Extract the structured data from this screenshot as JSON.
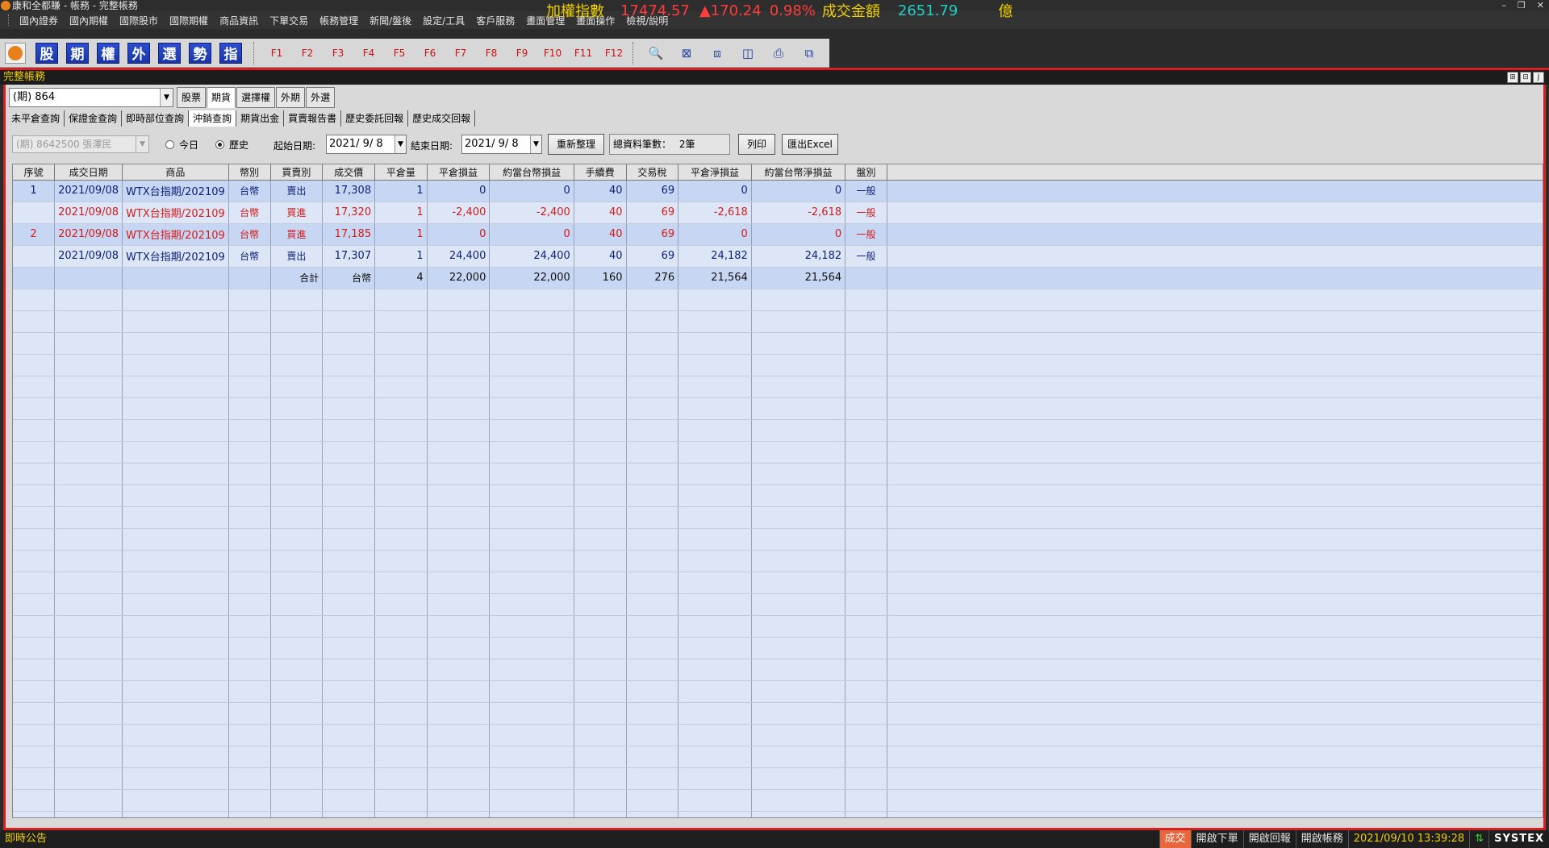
{
  "window": {
    "title": "康和全都賺 - 帳務 - 完整帳務",
    "min": "–",
    "max": "❐",
    "close": "✕"
  },
  "menu": [
    "國內證券",
    "國內期權",
    "國際股市",
    "國際期權",
    "商品資訊",
    "下單交易",
    "帳務管理",
    "新聞/盤後",
    "設定/工具",
    "客戶服務",
    "畫面管理",
    "畫面操作",
    "檢視/說明"
  ],
  "ticker": {
    "label1": "加權指數",
    "index": "17474.57",
    "change": "▲170.24",
    "pct": "0.98%",
    "label2": "成交金額",
    "amount": "2651.79",
    "unit": "億"
  },
  "toolbar": {
    "chars": [
      "股",
      "期",
      "權",
      "外",
      "選",
      "勢",
      "指"
    ],
    "fkeys": [
      "F1",
      "F2",
      "F3",
      "F4",
      "F5",
      "F6",
      "F7",
      "F8",
      "F9",
      "F10",
      "F11",
      "F12"
    ],
    "icons": [
      "🔍",
      "⊠",
      "⧈",
      "◫",
      "⎙",
      "⧉"
    ]
  },
  "subwindow": {
    "title": "完整帳務",
    "ctrls": [
      "⊞",
      "⊟",
      "J"
    ]
  },
  "account": {
    "value": "(期)  864"
  },
  "market_tabs": [
    "股票",
    "期貨",
    "選擇權",
    "外期",
    "外選"
  ],
  "query_tabs": [
    "未平倉查詢",
    "保證金查詢",
    "即時部位查詢",
    "沖銷查詢",
    "期貨出金",
    "買賣報告書",
    "歷史委託回報",
    "歷史成交回報"
  ],
  "filters": {
    "account": "(期)  8642500 張澤民",
    "today": "今日",
    "history": "歷史",
    "start_label": "起始日期:",
    "start_date": "2021/  9/  8",
    "end_label": "結束日期:",
    "end_date": "2021/  9/  8",
    "refresh": "重新整理",
    "count_label": "總資料筆數：",
    "count_value": "2筆",
    "print": "列印",
    "excel": "匯出Excel"
  },
  "grid": {
    "headers": [
      "序號",
      "成交日期",
      "商品",
      "幣別",
      "買賣別",
      "成交價",
      "平倉量",
      "平倉損益",
      "約當台幣損益",
      "手續費",
      "交易稅",
      "平倉淨損益",
      "約當台幣淨損益",
      "盤別"
    ],
    "rows": [
      [
        "1",
        "2021/09/08",
        "WTX台指期/202109",
        "台幣",
        "賣出",
        "17,308",
        "1",
        "0",
        "0",
        "40",
        "69",
        "0",
        "0",
        "一般"
      ],
      [
        "",
        "2021/09/08",
        "WTX台指期/202109",
        "台幣",
        "買進",
        "17,320",
        "1",
        "-2,400",
        "-2,400",
        "40",
        "69",
        "-2,618",
        "-2,618",
        "一般"
      ],
      [
        "2",
        "2021/09/08",
        "WTX台指期/202109",
        "台幣",
        "買進",
        "17,185",
        "1",
        "0",
        "0",
        "40",
        "69",
        "0",
        "0",
        "一般"
      ],
      [
        "",
        "2021/09/08",
        "WTX台指期/202109",
        "台幣",
        "賣出",
        "17,307",
        "1",
        "24,400",
        "24,400",
        "40",
        "69",
        "24,182",
        "24,182",
        "一般"
      ]
    ],
    "total": [
      "",
      "",
      "",
      "",
      "合計",
      "台幣",
      "4",
      "22,000",
      "22,000",
      "160",
      "276",
      "21,564",
      "21,564",
      ""
    ]
  },
  "status": {
    "left": "即時公告",
    "deal": "成交",
    "items": [
      "開啟下單",
      "開啟回報",
      "開啟帳務"
    ],
    "time": "2021/09/10 13:39:28",
    "brand": "SYSTEX"
  }
}
